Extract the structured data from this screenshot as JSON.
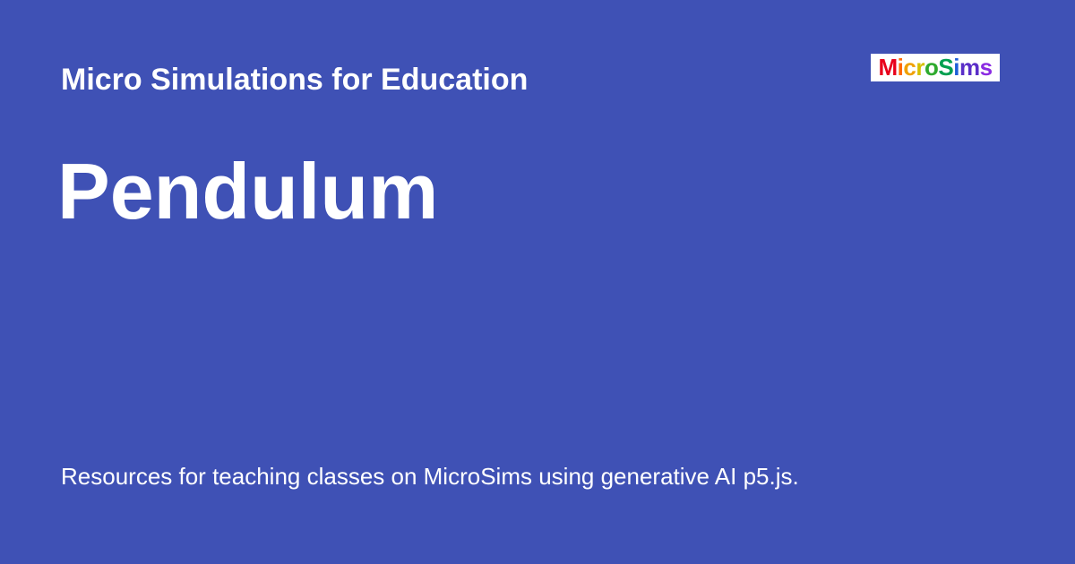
{
  "theme": {
    "background": "#3f51b5",
    "text": "#ffffff"
  },
  "site": {
    "name": "Micro Simulations for Education"
  },
  "page": {
    "title": "Pendulum",
    "description": "Resources for teaching classes on MicroSims using generative AI p5.js."
  },
  "logo": {
    "text": "MicroSims",
    "letter_colors": [
      "#e8001c",
      "#ff6a00",
      "#f0a000",
      "#d4c000",
      "#2eaa2e",
      "#00a050",
      "#1e5fd8",
      "#5a2ec8",
      "#8a2be2"
    ]
  }
}
